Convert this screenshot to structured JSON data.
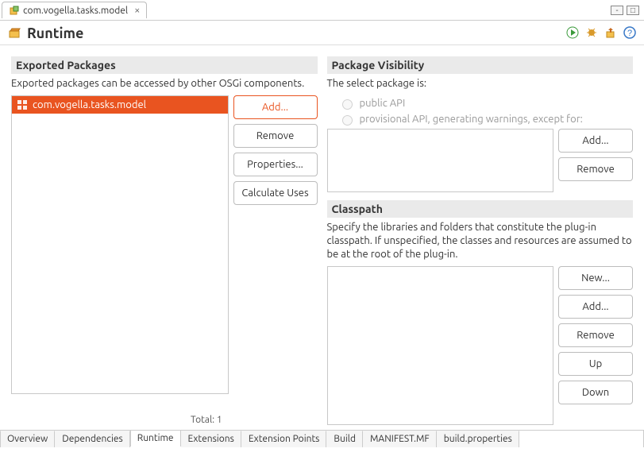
{
  "editor_tab": {
    "label": "com.vogella.tasks.model",
    "close_tooltip": "Close"
  },
  "page": {
    "title": "Runtime"
  },
  "toolbar_icons": [
    "run",
    "debug-bug",
    "export",
    "help"
  ],
  "exported": {
    "section_title": "Exported Packages",
    "description": "Exported packages can be accessed by other OSGi components.",
    "items": [
      "com.vogella.tasks.model"
    ],
    "buttons": {
      "add": "Add...",
      "remove": "Remove",
      "properties": "Properties...",
      "calc": "Calculate Uses"
    },
    "total_label": "Total: 1"
  },
  "visibility": {
    "section_title": "Package Visibility",
    "description": "The select package is:",
    "radio_public": "public API",
    "radio_provisional": "provisional API, generating warnings, except for:",
    "buttons": {
      "add": "Add...",
      "remove": "Remove"
    }
  },
  "classpath": {
    "section_title": "Classpath",
    "description": "Specify the libraries and folders that constitute the plug-in classpath.  If unspecified, the classes and resources are assumed to be at the root of the plug-in.",
    "buttons": {
      "new": "New...",
      "add": "Add...",
      "remove": "Remove",
      "up": "Up",
      "down": "Down"
    }
  },
  "footer_tabs": [
    "Overview",
    "Dependencies",
    "Runtime",
    "Extensions",
    "Extension Points",
    "Build",
    "MANIFEST.MF",
    "build.properties"
  ],
  "footer_active_index": 2
}
